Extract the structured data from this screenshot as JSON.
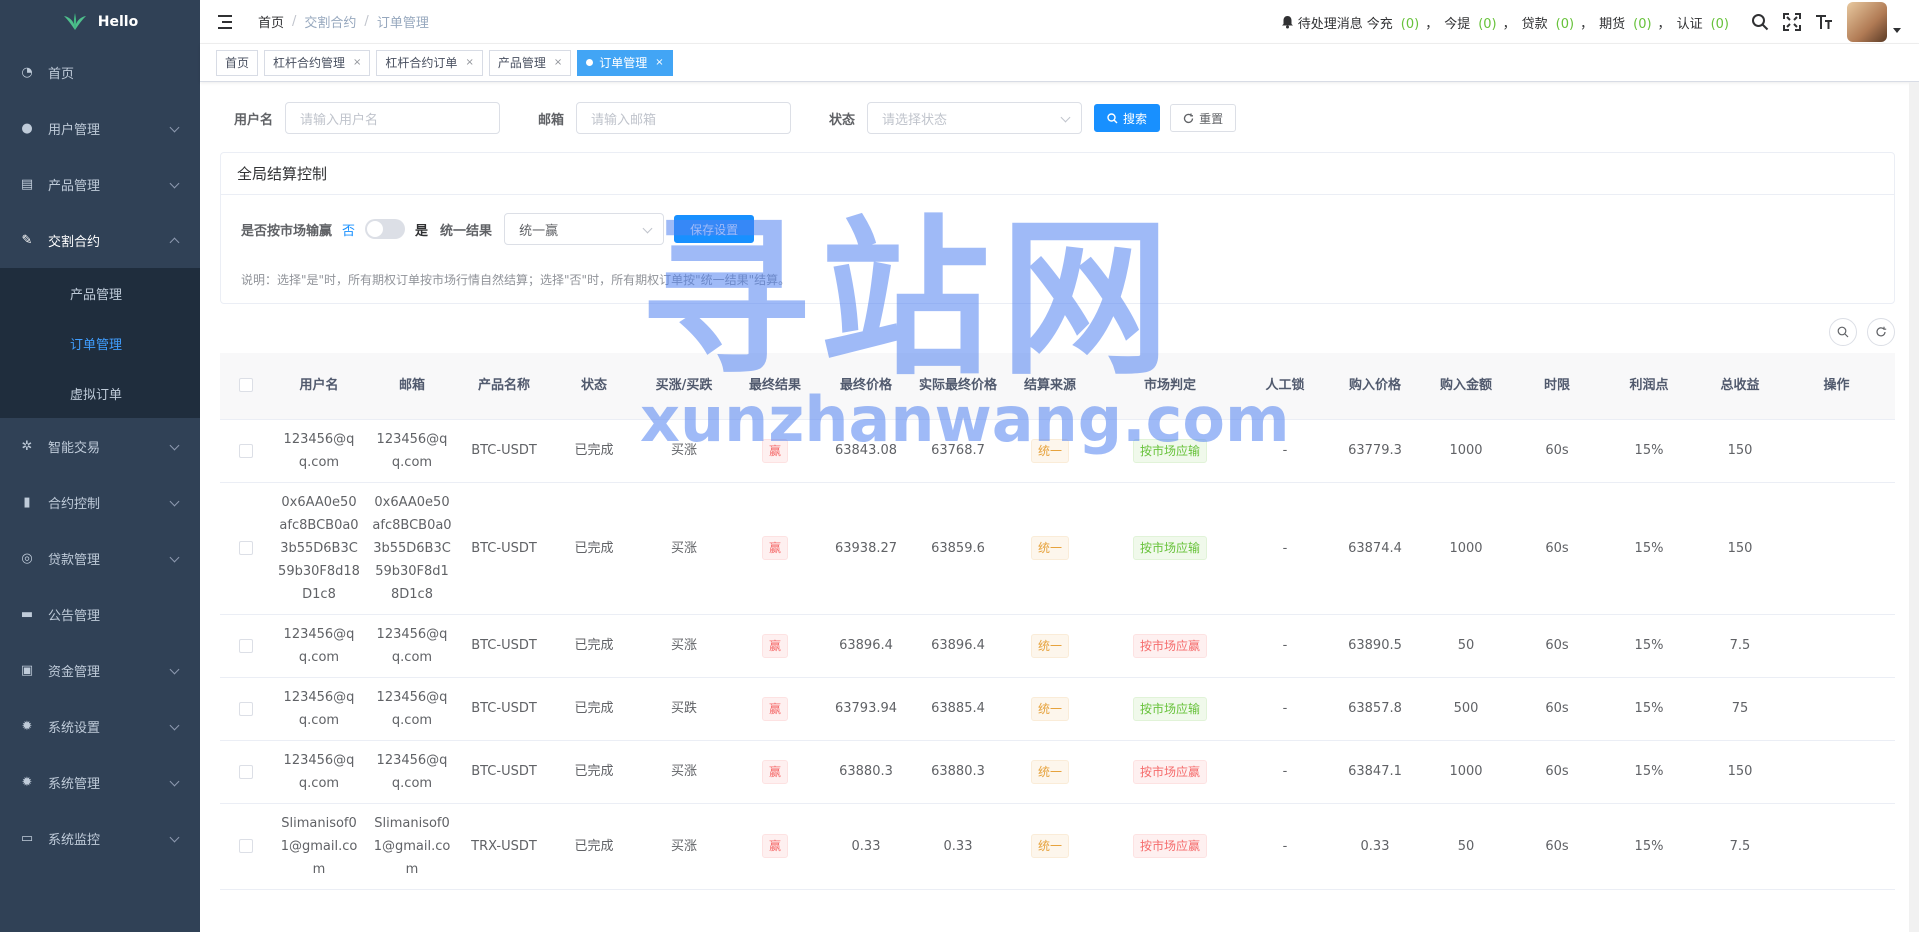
{
  "app": {
    "logo_text": "Hello"
  },
  "sidebar": {
    "items": [
      {
        "label": "首页",
        "icon": "dashboard-icon",
        "chevron": false
      },
      {
        "label": "用户管理",
        "icon": "user-icon",
        "chevron": true
      },
      {
        "label": "产品管理",
        "icon": "document-icon",
        "chevron": true
      },
      {
        "label": "交割合约",
        "icon": "edit-icon",
        "chevron": true,
        "expanded": true
      },
      {
        "label": "智能交易",
        "icon": "gear-small-icon",
        "chevron": true
      },
      {
        "label": "合约控制",
        "icon": "bar-chart-icon",
        "chevron": true
      },
      {
        "label": "贷款管理",
        "icon": "money-icon",
        "chevron": true
      },
      {
        "label": "公告管理",
        "icon": "message-icon",
        "chevron": false
      },
      {
        "label": "资金管理",
        "icon": "wallet-icon",
        "chevron": true
      },
      {
        "label": "系统设置",
        "icon": "settings-icon",
        "chevron": true
      },
      {
        "label": "系统管理",
        "icon": "system-icon",
        "chevron": true
      },
      {
        "label": "系统监控",
        "icon": "monitor-icon",
        "chevron": true
      }
    ],
    "submenu": [
      {
        "label": "产品管理",
        "active": false
      },
      {
        "label": "订单管理",
        "active": true
      },
      {
        "label": "虚拟订单",
        "active": false
      }
    ]
  },
  "navbar": {
    "breadcrumb": [
      "首页",
      "交割合约",
      "订单管理"
    ],
    "notice_label": "待处理消息",
    "counters": [
      {
        "label": "今充",
        "value": "(0)"
      },
      {
        "label": "今提",
        "value": "(0)"
      },
      {
        "label": "贷款",
        "value": "(0)"
      },
      {
        "label": "期货",
        "value": "(0)"
      },
      {
        "label": "认证",
        "value": "(0)"
      }
    ],
    "sep": "，"
  },
  "tags": [
    {
      "label": "首页",
      "closable": false,
      "active": false
    },
    {
      "label": "杠杆合约管理",
      "closable": true,
      "active": false
    },
    {
      "label": "杠杆合约订单",
      "closable": true,
      "active": false
    },
    {
      "label": "产品管理",
      "closable": true,
      "active": false
    },
    {
      "label": "订单管理",
      "closable": true,
      "active": true
    }
  ],
  "search": {
    "username_label": "用户名",
    "username_placeholder": "请输入用户名",
    "email_label": "邮箱",
    "email_placeholder": "请输入邮箱",
    "status_label": "状态",
    "status_placeholder": "请选择状态",
    "search_btn": "搜索",
    "reset_btn": "重置"
  },
  "global_control": {
    "title": "全局结算控制",
    "market_label": "是否按市场输赢",
    "no": "否",
    "yes": "是",
    "result_label": "统一结果",
    "result_value": "统一赢",
    "save_btn": "保存设置",
    "note": "说明：选择\"是\"时，所有期权订单按市场行情自然结算；选择\"否\"时，所有期权订单按\"统一结果\"结算。"
  },
  "table": {
    "columns": [
      "用户名",
      "邮箱",
      "产品名称",
      "状态",
      "买涨/买跌",
      "最终结果",
      "最终价格",
      "实际最终价格",
      "结算来源",
      "市场判定",
      "人工锁",
      "购入价格",
      "购入金额",
      "时限",
      "利润点",
      "总收益",
      "操作"
    ],
    "rows": [
      {
        "user": "123456@qq.com",
        "email": "123456@qq.com",
        "product": "BTC-USDT",
        "status": "已完成",
        "direction": "买涨",
        "result": "赢",
        "final_price": "63843.08",
        "actual_price": "63768.7",
        "source": "统一",
        "market": "按市场应输",
        "market_color": "green",
        "lock": "-",
        "buy_price": "63779.3",
        "amount": "1000",
        "period": "60s",
        "profit": "15%",
        "total": "150"
      },
      {
        "user": "0x6AA0e50afc8BCB0a03b55D6B3C59b30F8d18D1c8",
        "email": "0x6AA0e50afc8BCB0a03b55D6B3C59b30F8d18D1c8",
        "product": "BTC-USDT",
        "status": "已完成",
        "direction": "买涨",
        "result": "赢",
        "final_price": "63938.27",
        "actual_price": "63859.6",
        "source": "统一",
        "market": "按市场应输",
        "market_color": "green",
        "lock": "-",
        "buy_price": "63874.4",
        "amount": "1000",
        "period": "60s",
        "profit": "15%",
        "total": "150"
      },
      {
        "user": "123456@qq.com",
        "email": "123456@qq.com",
        "product": "BTC-USDT",
        "status": "已完成",
        "direction": "买涨",
        "result": "赢",
        "final_price": "63896.4",
        "actual_price": "63896.4",
        "source": "统一",
        "market": "按市场应赢",
        "market_color": "red",
        "lock": "-",
        "buy_price": "63890.5",
        "amount": "50",
        "period": "60s",
        "profit": "15%",
        "total": "7.5"
      },
      {
        "user": "123456@qq.com",
        "email": "123456@qq.com",
        "product": "BTC-USDT",
        "status": "已完成",
        "direction": "买跌",
        "result": "赢",
        "final_price": "63793.94",
        "actual_price": "63885.4",
        "source": "统一",
        "market": "按市场应输",
        "market_color": "green",
        "lock": "-",
        "buy_price": "63857.8",
        "amount": "500",
        "period": "60s",
        "profit": "15%",
        "total": "75"
      },
      {
        "user": "123456@qq.com",
        "email": "123456@qq.com",
        "product": "BTC-USDT",
        "status": "已完成",
        "direction": "买涨",
        "result": "赢",
        "final_price": "63880.3",
        "actual_price": "63880.3",
        "source": "统一",
        "market": "按市场应赢",
        "market_color": "red",
        "lock": "-",
        "buy_price": "63847.1",
        "amount": "1000",
        "period": "60s",
        "profit": "15%",
        "total": "150"
      },
      {
        "user": "Slimanisof01@gmail.com",
        "email": "Slimanisof01@gmail.com",
        "product": "TRX-USDT",
        "status": "已完成",
        "direction": "买涨",
        "result": "赢",
        "final_price": "0.33",
        "actual_price": "0.33",
        "source": "统一",
        "market": "按市场应赢",
        "market_color": "red",
        "lock": "-",
        "buy_price": "0.33",
        "amount": "50",
        "period": "60s",
        "profit": "15%",
        "total": "7.5"
      }
    ]
  },
  "watermark": {
    "main": "寻站网",
    "sub": "xunzhanwang.com"
  },
  "colors": {
    "sidebar_bg": "#304156",
    "submenu_bg": "#1f2d3d",
    "accent": "#1890ff",
    "tag_active": "#42a5f5"
  }
}
